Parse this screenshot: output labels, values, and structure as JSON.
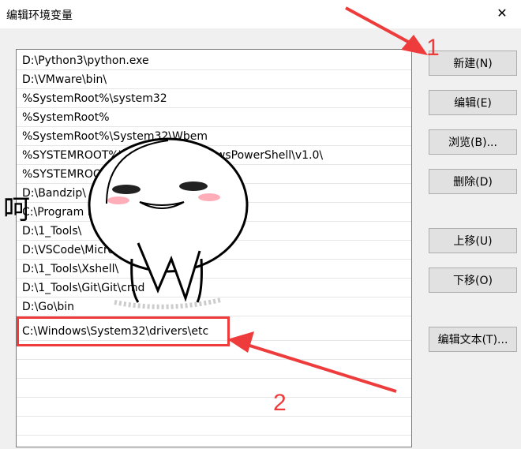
{
  "window": {
    "title": "编辑环境变量",
    "close_glyph": "✕"
  },
  "list": {
    "items": [
      "D:\\Python3\\python.exe",
      "D:\\VMware\\bin\\",
      "%SystemRoot%\\system32",
      "%SystemRoot%",
      "%SystemRoot%\\System32\\Wbem",
      "%SYSTEMROOT%\\System32\\WindowsPowerShell\\v1.0\\",
      "%SYSTEMROOT%\\System32\\OpenSSH\\",
      "D:\\Bandzip\\",
      "C:\\Program Files\\",
      "D:\\1_Tools\\",
      "D:\\VSCode\\Microsoft VS Code\\bin",
      "D:\\1_Tools\\Xshell\\",
      "D:\\1_Tools\\Git\\Git\\cmd",
      "D:\\Go\\bin",
      "C:\\Windows\\System32\\drivers\\etc"
    ]
  },
  "buttons": {
    "new": "新建(N)",
    "edit": "编辑(E)",
    "browse": "浏览(B)...",
    "delete": "删除(D)",
    "move_up": "上移(U)",
    "move_down": "下移(O)",
    "edit_text": "编辑文本(T)..."
  },
  "annotations": {
    "step1": "1",
    "step2": "2",
    "color": "#ee3b3b"
  },
  "sticker": {
    "text": "呵"
  }
}
